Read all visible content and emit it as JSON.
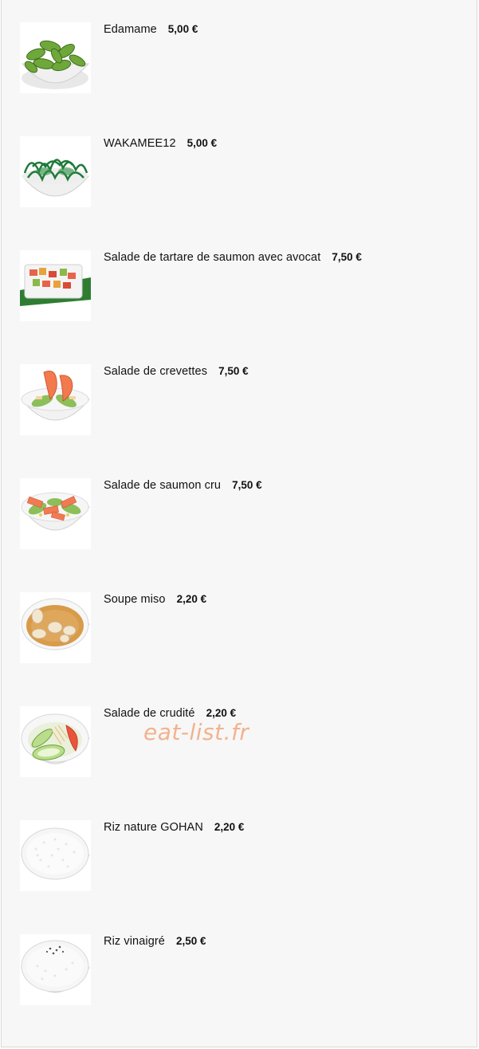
{
  "currency": "€",
  "watermark": "eat-list.fr",
  "items": [
    {
      "name": "Edamame",
      "price": "5,00 €",
      "image": "edamame-bowl"
    },
    {
      "name": "WAKAMEE12",
      "price": "5,00 €",
      "image": "seaweed-salad-bowl"
    },
    {
      "name": "Salade de tartare de saumon avec avocat",
      "price": "7,50 €",
      "image": "salmon-tartare-plate"
    },
    {
      "name": "Salade de crevettes",
      "price": "7,50 €",
      "image": "shrimp-salad-bowl"
    },
    {
      "name": "Salade de saumon cru",
      "price": "7,50 €",
      "image": "raw-salmon-salad-bowl"
    },
    {
      "name": "Soupe miso",
      "price": "2,20 €",
      "image": "miso-soup-bowl"
    },
    {
      "name": "Salade de crudité",
      "price": "2,20 €",
      "image": "crudite-salad-bowl"
    },
    {
      "name": "Riz nature GOHAN",
      "price": "2,20 €",
      "image": "plain-rice-bowl"
    },
    {
      "name": "Riz vinaigré",
      "price": "2,50 €",
      "image": "vinegar-rice-bowl"
    }
  ]
}
